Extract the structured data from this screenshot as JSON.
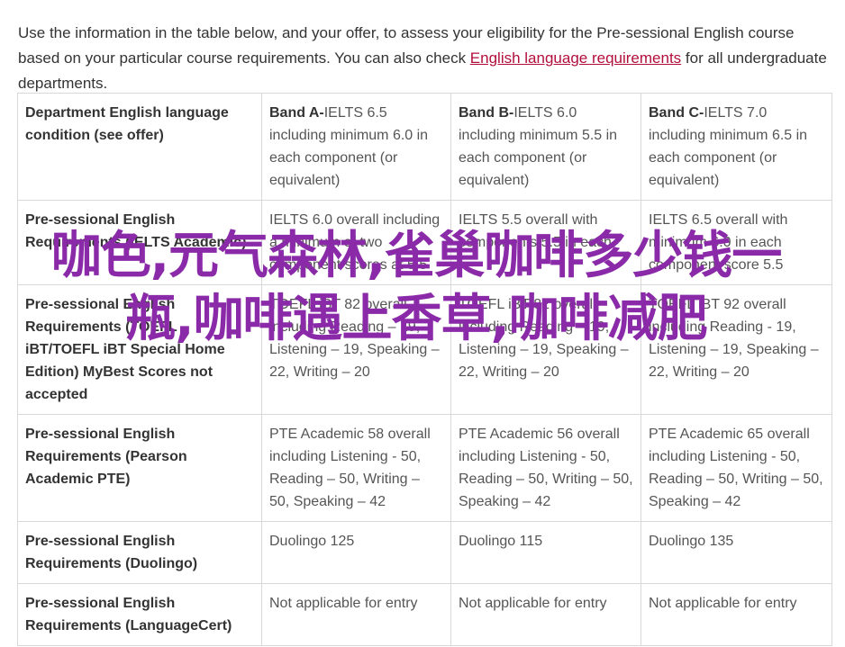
{
  "intro": {
    "text_before": "Use the information in the table below, and your offer, to assess your eligibility for the Pre-sessional English course based on your particular course requirements. You can also check ",
    "link_label": "English language requirements",
    "text_after": " for all undergraduate departments."
  },
  "table": {
    "header": {
      "condition": "Department English language condition (see offer)",
      "bands": [
        {
          "name": "Band A-",
          "detail": "IELTS 6.5 including minimum 6.0 in each component (or equivalent)"
        },
        {
          "name": "Band B-",
          "detail": "IELTS 6.0 including minimum 5.5 in each component (or equivalent)"
        },
        {
          "name": "Band C-",
          "detail": "IELTS 7.0 including minimum 6.5 in each component (or equivalent)"
        }
      ]
    },
    "rows": [
      {
        "label": "Pre-sessional English Requirements (IELTS Academic)",
        "values": [
          "IELTS 6.0 overall including a minimum of two component scores at 5.5",
          "IELTS 5.5 overall with components 5.5 in each",
          "IELTS 6.5 overall with minimum 6.0 in each component score 5.5"
        ]
      },
      {
        "label": "Pre-sessional English Requirements (TOEFL iBT/TOEFL iBT Special Home Edition) MyBest Scores not accepted",
        "values": [
          "TOEFL iBT 82 overall including Reading – 19, Listening – 19, Speaking – 22, Writing – 20",
          "TOEFL iBT 82 overall including Reading – 19, Listening – 19, Speaking – 22, Writing – 20",
          "TOEFL iBT 92 overall including Reading - 19, Listening – 19, Speaking – 22, Writing – 20"
        ]
      },
      {
        "label": "Pre-sessional English Requirements (Pearson Academic PTE)",
        "values": [
          "PTE Academic 58 overall including Listening - 50, Reading – 50, Writing – 50, Speaking – 42",
          "PTE Academic 56 overall including Listening - 50, Reading – 50, Writing – 50, Speaking – 42",
          "PTE Academic 65 overall including Listening - 50, Reading – 50, Writing – 50, Speaking – 42"
        ]
      },
      {
        "label": "Pre-sessional English Requirements (Duolingo)",
        "values": [
          "Duolingo 125",
          "Duolingo 115",
          "Duolingo 135"
        ]
      },
      {
        "label": "Pre-sessional English Requirements (LanguageCert)",
        "values": [
          "Not applicable for entry",
          "Not applicable for entry",
          "Not applicable for entry"
        ]
      }
    ]
  },
  "overlay_text": "咖色,元气森林,雀巢咖啡多少钱一瓶,咖啡遇上香草,咖啡减肥",
  "colors": {
    "link": "#b20e3b",
    "overlay": "#8a2aa8",
    "border": "#d8d8d8"
  }
}
